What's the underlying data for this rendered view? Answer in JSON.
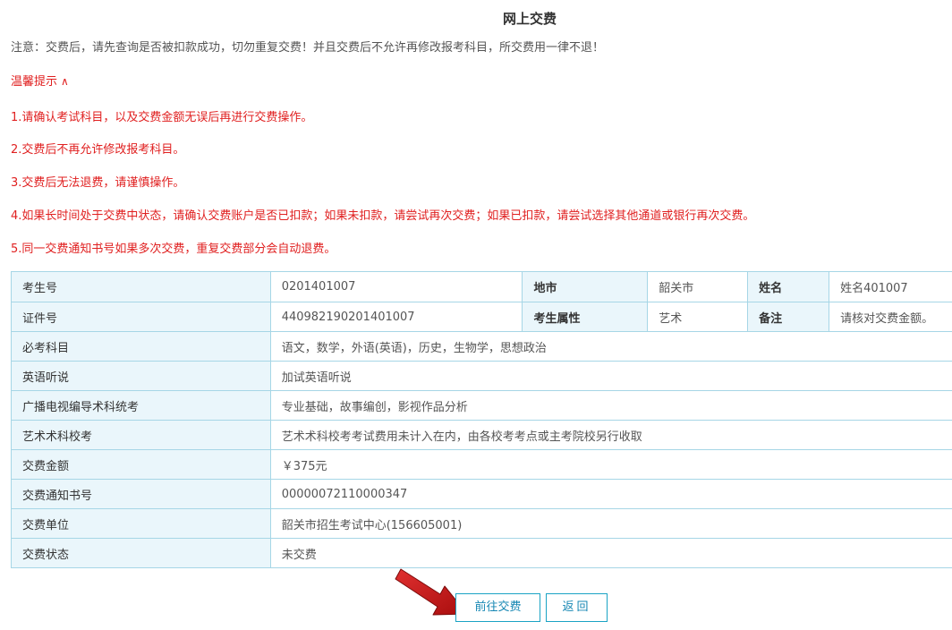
{
  "header": {
    "title": "网上交费"
  },
  "notice": "注意：交费后，请先查询是否被扣款成功，切勿重复交费！并且交费后不允许再修改报考科目，所交费用一律不退！",
  "tips": {
    "toggle_label": "温馨提示",
    "toggle_icon": "chevron-up-icon",
    "items": [
      "1.请确认考试科目，以及交费金额无误后再进行交费操作。",
      "2.交费后不再允许修改报考科目。",
      "3.交费后无法退费，请谨慎操作。",
      "4.如果长时间处于交费中状态，请确认交费账户是否已扣款；如果未扣款，请尝试再次交费；如果已扣款，请尝试选择其他通道或银行再次交费。",
      "5.同一交费通知书号如果多次交费，重复交费部分会自动退费。"
    ]
  },
  "info": {
    "row1": {
      "exam_no_label": "考生号",
      "exam_no": "0201401007",
      "city_label": "地市",
      "city": "韶关市",
      "name_label": "姓名",
      "name": "姓名401007"
    },
    "row2": {
      "id_label": "证件号",
      "id_no": "440982190201401007",
      "attr_label": "考生属性",
      "attr": "艺术",
      "remark_label": "备注",
      "remark": "请核对交费金额。"
    },
    "rows": [
      {
        "label": "必考科目",
        "value": "语文，数学，外语(英语)，历史，生物学，思想政治"
      },
      {
        "label": "英语听说",
        "value": "加试英语听说"
      },
      {
        "label": "广播电视编导术科统考",
        "value": "专业基础，故事编创，影视作品分析"
      },
      {
        "label": "艺术术科校考",
        "value": "艺术术科校考考试费用未计入在内，由各校考考点或主考院校另行收取"
      },
      {
        "label": "交费金额",
        "value": "￥375元"
      },
      {
        "label": "交费通知书号",
        "value": "00000072110000347"
      },
      {
        "label": "交费单位",
        "value": "韶关市招生考试中心(156605001)"
      },
      {
        "label": "交费状态",
        "value": "未交费"
      }
    ]
  },
  "actions": {
    "pay_label": "前往交费",
    "back_label": "返回"
  },
  "annotation": {
    "arrow_color": "#cc1111"
  },
  "colors": {
    "tip_red": "#e02020",
    "table_border": "#a6d6e6",
    "label_bg": "#eaf6fb",
    "button_border": "#1aa3c4",
    "button_text": "#1687b3"
  }
}
